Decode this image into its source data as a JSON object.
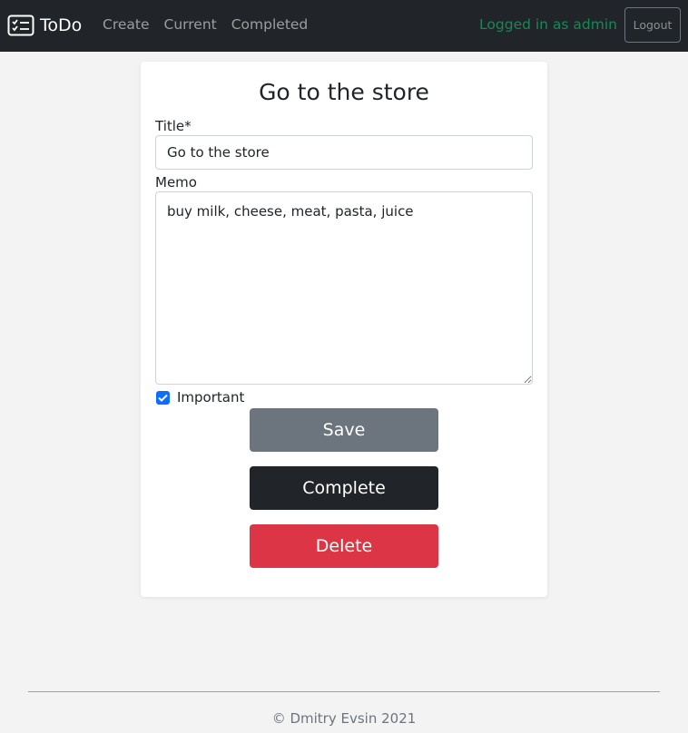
{
  "navbar": {
    "brand": "ToDo",
    "brand_icon": "checklist-icon",
    "links": [
      "Create",
      "Current",
      "Completed"
    ],
    "logged_in_text": "Logged in as admin",
    "logout_label": "Logout"
  },
  "form": {
    "heading": "Go to the store",
    "title_label": "Title*",
    "title_value": "Go to the store",
    "memo_label": "Memo",
    "memo_value": "buy milk, cheese, meat, pasta, juice",
    "important_label": "Important",
    "important_checked": true,
    "save_label": "Save",
    "complete_label": "Complete",
    "delete_label": "Delete"
  },
  "footer": {
    "text": "© Dmitry Evsin 2021"
  },
  "colors": {
    "navbar_bg": "#212529",
    "logged_in": "#198754",
    "save": "#6c757d",
    "complete": "#212529",
    "delete": "#dc3545",
    "checkbox": "#0d6efd"
  }
}
